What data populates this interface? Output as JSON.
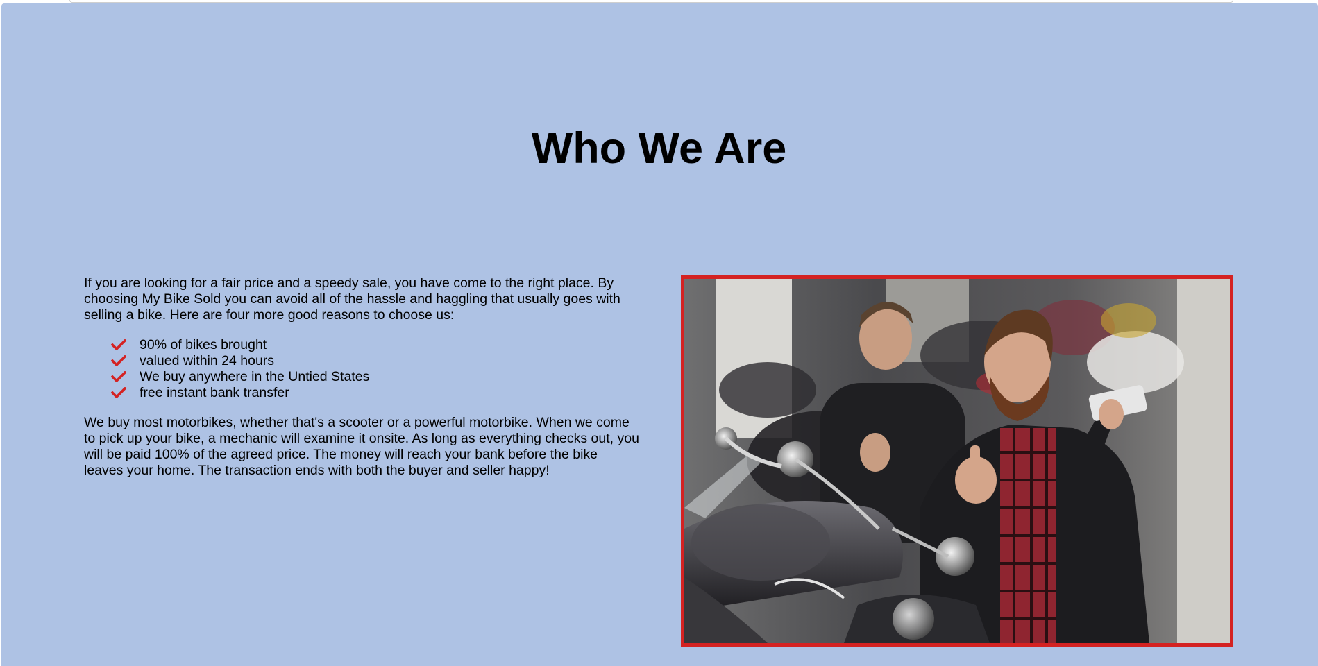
{
  "section": {
    "title": "Who We Are",
    "intro": "If you are looking for a fair price and a speedy sale, you have come to the right place. By choosing My Bike Sold you can avoid all of the hassle and haggling that usually goes with selling a bike. Here are four more good reasons to choose us:",
    "reasons": [
      "90% of bikes brought",
      "valued within 24 hours",
      "We buy anywhere in the Untied States",
      "free instant bank transfer"
    ],
    "body": "We buy most motorbikes, whether that's a scooter or a powerful motorbike. When we come to pick up your bike, a mechanic will examine it onsite. As long as everything checks out, you will be paid 100% of the agreed price. The money will reach your bank before the bike leaves your home. The transaction ends with both the buyer and seller happy!"
  },
  "icons": {
    "reason_bullet": "check-icon",
    "photo": "two-bikers-selfie-photo"
  },
  "colors": {
    "section_background": "#aec2e4",
    "accent": "#d42222"
  }
}
